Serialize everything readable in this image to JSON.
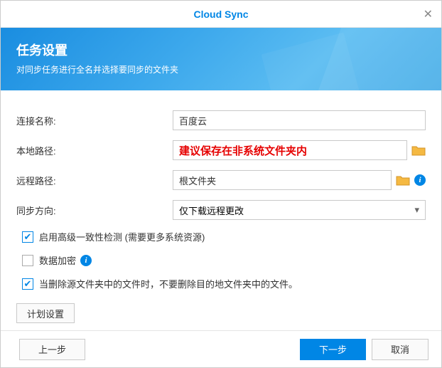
{
  "window": {
    "title": "Cloud Sync"
  },
  "banner": {
    "heading": "任务设置",
    "desc": "对同步任务进行全名并选择要同步的文件夹"
  },
  "form": {
    "conn_label": "连接名称:",
    "conn_value": "百度云",
    "local_label": "本地路径:",
    "local_value": "建议保存在非系统文件夹内",
    "remote_label": "远程路径:",
    "remote_value": "根文件夹",
    "dir_label": "同步方向:",
    "dir_value": "仅下载远程更改"
  },
  "options": {
    "adv_check": "启用高级一致性检测 (需要更多系统资源)",
    "encrypt": "数据加密",
    "delete_rule": "当删除源文件夹中的文件时，不要删除目的地文件夹中的文件。"
  },
  "schedule_btn": "计划设置",
  "footer": {
    "prev": "上一步",
    "next": "下一步",
    "cancel": "取消"
  }
}
